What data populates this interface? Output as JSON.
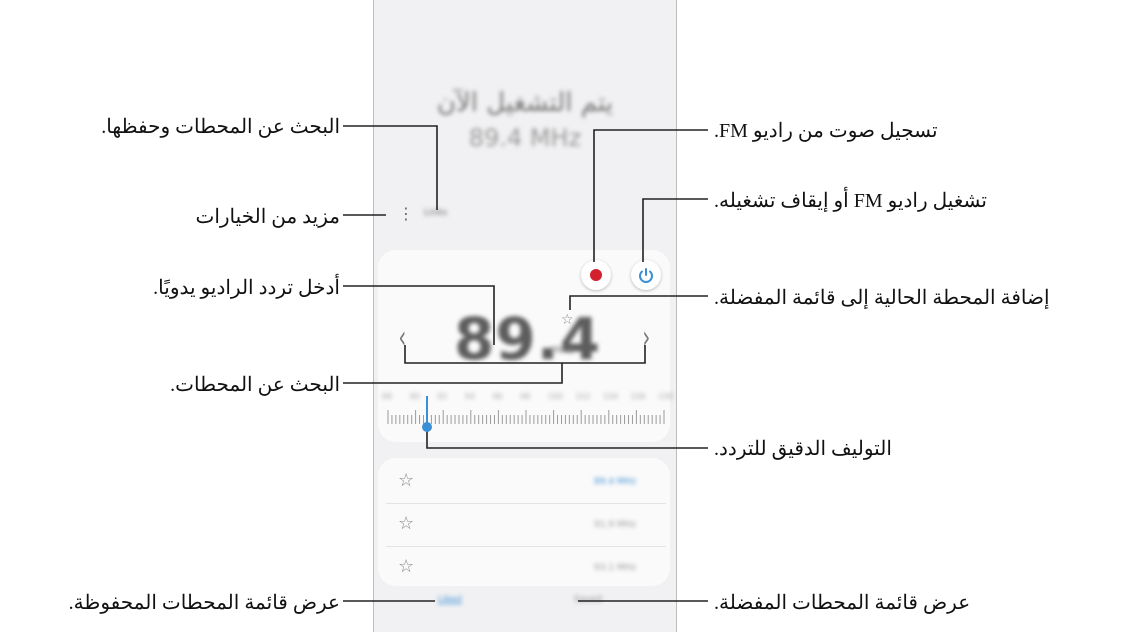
{
  "phone": {
    "now_playing_title": "يتم التشغيل الآن",
    "now_playing_freq": "89.4 MHz",
    "more_options_icon": "⋮",
    "more_label": "Links",
    "frequency": "89.4",
    "unit": "MHz",
    "prev_icon": "‹",
    "next_icon": "›",
    "scale": [
      "88",
      "90",
      "92",
      "94",
      "96",
      "98",
      "100",
      "102",
      "104",
      "106",
      "108"
    ],
    "tuner_position": 0.1,
    "stations": [
      {
        "freq": "89.4 MHz",
        "active": true
      },
      {
        "freq": "91.9 MHz",
        "active": false
      },
      {
        "freq": "93.1 MHz",
        "active": false
      }
    ],
    "tab_stations": "Liked",
    "tab_favorites": "Saved"
  },
  "annotations": {
    "scan_save": "البحث عن المحطات وحفظها.",
    "more_options": "مزيد من الخيارات",
    "enter_freq": "أدخل تردد الراديو يدويًا.",
    "search": "البحث عن المحطات.",
    "saved_list": "عرض قائمة المحطات المحفوظة.",
    "record": "تسجيل صوت من راديو FM.",
    "power": "تشغيل راديو FM أو إيقاف تشغيله.",
    "add_favorite": "إضافة المحطة الحالية إلى قائمة المفضلة.",
    "fine_tune": "التوليف الدقيق للتردد.",
    "favorites_list": "عرض قائمة المحطات المفضلة."
  },
  "colors": {
    "accent": "#3b8fd6",
    "record": "#d2202f"
  },
  "icons": {
    "record": "record-icon",
    "power": "power-icon",
    "star": "star-icon",
    "prev": "chevron-left-icon",
    "next": "chevron-right-icon",
    "more": "more-vertical-icon"
  }
}
